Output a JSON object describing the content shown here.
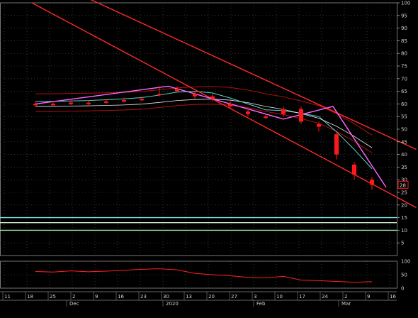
{
  "chart_data": {
    "type": "candlestick",
    "title": "",
    "xlabel": "",
    "ylabel": "",
    "ylim": [
      0,
      100
    ],
    "grid": true,
    "y_ticks": [
      5,
      10,
      15,
      20,
      25,
      30,
      35,
      40,
      45,
      50,
      55,
      60,
      65,
      70,
      75,
      80,
      85,
      90,
      95,
      100
    ],
    "x_tick_labels": [
      "11",
      "18",
      "25",
      "2",
      "9",
      "16",
      "23",
      "30",
      "13",
      "20",
      "27",
      "3",
      "10",
      "17",
      "24",
      "2",
      "9",
      "16"
    ],
    "month_labels": [
      "Dec",
      "2020",
      "Feb",
      "Mar"
    ],
    "last_price_label": "28",
    "horizontal_levels": [
      15,
      13,
      10
    ],
    "candles": [
      {
        "date": "2019-11-11",
        "o": 60,
        "h": 61,
        "l": 59,
        "c": 60
      },
      {
        "date": "2019-11-18",
        "o": 60,
        "h": 61,
        "l": 59.5,
        "c": 60
      },
      {
        "date": "2019-11-25",
        "o": 60.5,
        "h": 61.5,
        "l": 59.5,
        "c": 60.5
      },
      {
        "date": "2019-12-02",
        "o": 60.5,
        "h": 61.5,
        "l": 59,
        "c": 60.5
      },
      {
        "date": "2019-12-09",
        "o": 61,
        "h": 62,
        "l": 60,
        "c": 61
      },
      {
        "date": "2019-12-16",
        "o": 61.5,
        "h": 62.5,
        "l": 60.5,
        "c": 61.5
      },
      {
        "date": "2019-12-23",
        "o": 62,
        "h": 63,
        "l": 61,
        "c": 62
      },
      {
        "date": "2019-12-30",
        "o": 64,
        "h": 67,
        "l": 63,
        "c": 64
      },
      {
        "date": "2020-01-06",
        "o": 66,
        "h": 67,
        "l": 65,
        "c": 65
      },
      {
        "date": "2020-01-13",
        "o": 64,
        "h": 65,
        "l": 62,
        "c": 63
      },
      {
        "date": "2020-01-20",
        "o": 63,
        "h": 64,
        "l": 61,
        "c": 62
      },
      {
        "date": "2020-01-27",
        "o": 60,
        "h": 61,
        "l": 58,
        "c": 59
      },
      {
        "date": "2020-02-03",
        "o": 57,
        "h": 58,
        "l": 55,
        "c": 56
      },
      {
        "date": "2020-02-10",
        "o": 55,
        "h": 56,
        "l": 54,
        "c": 55
      },
      {
        "date": "2020-02-17",
        "o": 56,
        "h": 59,
        "l": 55,
        "c": 58
      },
      {
        "date": "2020-02-24",
        "o": 58,
        "h": 59,
        "l": 52,
        "c": 53
      },
      {
        "date": "2020-03-02",
        "o": 52,
        "h": 53,
        "l": 49,
        "c": 51
      },
      {
        "date": "2020-03-09",
        "o": 48,
        "h": 49,
        "l": 38,
        "c": 40
      },
      {
        "date": "2020-03-16",
        "o": 36,
        "h": 37,
        "l": 30,
        "c": 32
      },
      {
        "date": "2020-03-23",
        "o": 30,
        "h": 31,
        "l": 26,
        "c": 28
      }
    ],
    "trendlines": [
      {
        "name": "upper-channel-line",
        "color": "#ff2a2a",
        "x0": -0.2,
        "y0": 112,
        "x1": 21.5,
        "y1": 42
      },
      {
        "name": "lower-channel-line",
        "color": "#ff2a2a",
        "x0": -0.2,
        "y0": 100,
        "x1": 21.5,
        "y1": 19
      },
      {
        "name": "zigzag-line",
        "color": "#ff66ff",
        "points": [
          [
            0,
            60
          ],
          [
            7.5,
            67
          ],
          [
            14,
            54
          ],
          [
            16.8,
            59
          ],
          [
            19.8,
            27
          ]
        ]
      }
    ],
    "oscillator": {
      "ylim": [
        0,
        100
      ],
      "y_ticks": [
        100,
        50,
        0
      ],
      "values": [
        62,
        60,
        64,
        61,
        63,
        66,
        70,
        72,
        68,
        55,
        50,
        46,
        40,
        38,
        44,
        30,
        28,
        25,
        22,
        24
      ]
    },
    "colors": {
      "background": "#000000",
      "grid": "#555555",
      "candle": "#ff1a1a",
      "channel": "#ff2a2a",
      "zigzag": "#ff66ff",
      "band": "#b01010",
      "ma_fast": "#5fd0c8",
      "ma_slow": "#e8e8e8",
      "level_lines": [
        "#7fe6e6",
        "#cfeccf",
        "#9fe09f"
      ],
      "oscillator": "#ff2020"
    }
  }
}
